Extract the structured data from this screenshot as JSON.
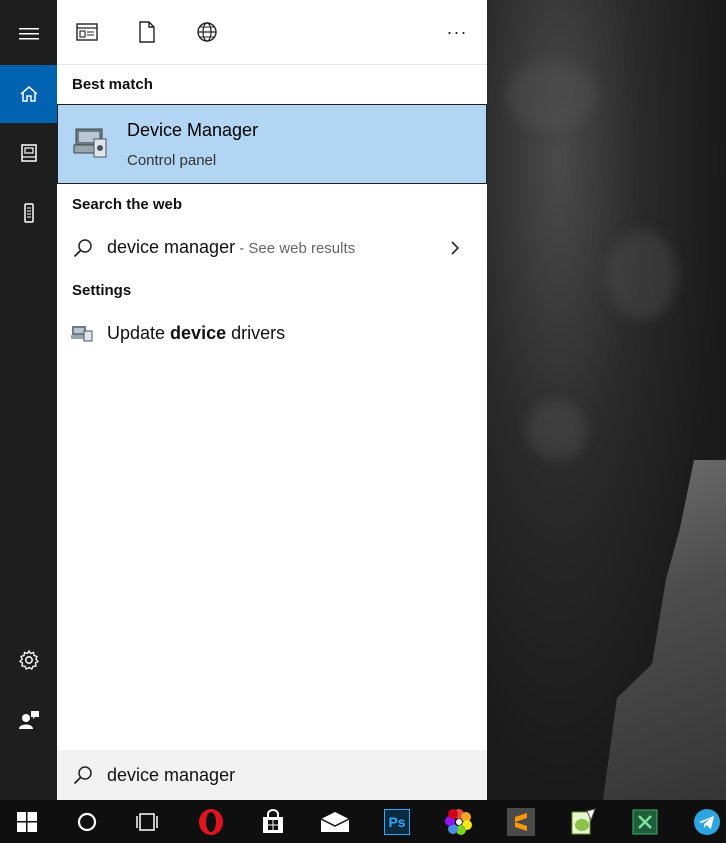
{
  "search": {
    "query": "device manager",
    "placeholder": ""
  },
  "rail": {
    "items": [
      "hamburger-menu",
      "home",
      "notebook",
      "devices",
      "settings",
      "feedback"
    ]
  },
  "filters": {
    "icons": [
      "apps-filter",
      "documents-filter",
      "web-filter",
      "more-options"
    ],
    "more_label": "···"
  },
  "results": {
    "best_match_header": "Best match",
    "best_match": {
      "title": "Device Manager",
      "subtitle": "Control panel"
    },
    "web_header": "Search the web",
    "web_item": {
      "query": "device manager",
      "hint": " - See web results"
    },
    "settings_header": "Settings",
    "settings_item": {
      "prefix": "Update ",
      "bold": "device",
      "suffix": " drivers"
    }
  },
  "taskbar": {
    "apps": [
      "start",
      "cortana",
      "task-view",
      "opera",
      "store",
      "mail",
      "photoshop",
      "pinwheel-app",
      "sublime-text",
      "notepad-plus-plus",
      "excel-like-app",
      "telegram"
    ],
    "ps_label": "Ps"
  },
  "colors": {
    "accent": "#0063b1",
    "highlight": "#b1d5f2",
    "rail": "#1e1e1e",
    "taskbar": "#0f0f0f"
  }
}
